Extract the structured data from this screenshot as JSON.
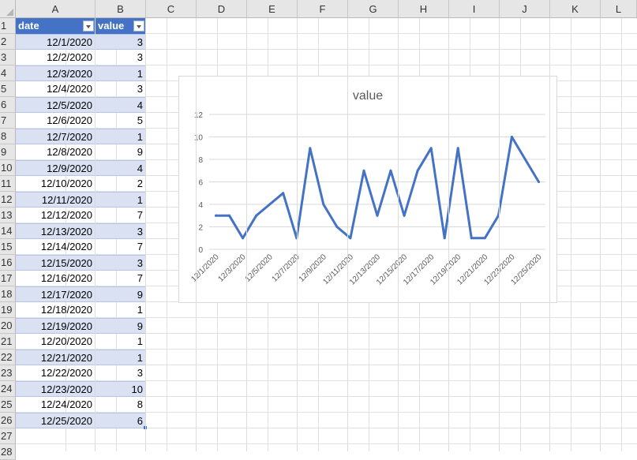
{
  "columns": [
    "A",
    "B",
    "C",
    "D",
    "E",
    "F",
    "G",
    "H",
    "I",
    "J",
    "K",
    "L"
  ],
  "rows": [
    "1",
    "2",
    "3",
    "4",
    "5",
    "6",
    "7",
    "8",
    "9",
    "10",
    "11",
    "12",
    "13",
    "14",
    "15",
    "16",
    "17",
    "18",
    "19",
    "20",
    "21",
    "22",
    "23",
    "24",
    "25",
    "26",
    "27",
    "28"
  ],
  "table": {
    "headers": [
      "date",
      "value"
    ],
    "dates": [
      "12/1/2020",
      "12/2/2020",
      "12/3/2020",
      "12/4/2020",
      "12/5/2020",
      "12/6/2020",
      "12/7/2020",
      "12/8/2020",
      "12/9/2020",
      "12/10/2020",
      "12/11/2020",
      "12/12/2020",
      "12/13/2020",
      "12/14/2020",
      "12/15/2020",
      "12/16/2020",
      "12/17/2020",
      "12/18/2020",
      "12/19/2020",
      "12/20/2020",
      "12/21/2020",
      "12/22/2020",
      "12/23/2020",
      "12/24/2020",
      "12/25/2020"
    ],
    "values": [
      "3",
      "3",
      "1",
      "3",
      "4",
      "5",
      "1",
      "9",
      "4",
      "2",
      "1",
      "7",
      "3",
      "7",
      "3",
      "7",
      "9",
      "1",
      "9",
      "1",
      "1",
      "3",
      "10",
      "8",
      "6"
    ]
  },
  "chart_data": {
    "type": "line",
    "title": "value",
    "x": [
      "12/1/2020",
      "12/2/2020",
      "12/3/2020",
      "12/4/2020",
      "12/5/2020",
      "12/6/2020",
      "12/7/2020",
      "12/8/2020",
      "12/9/2020",
      "12/10/2020",
      "12/11/2020",
      "12/12/2020",
      "12/13/2020",
      "12/14/2020",
      "12/15/2020",
      "12/16/2020",
      "12/17/2020",
      "12/18/2020",
      "12/19/2020",
      "12/20/2020",
      "12/21/2020",
      "12/22/2020",
      "12/23/2020",
      "12/24/2020",
      "12/25/2020"
    ],
    "series": [
      {
        "values": [
          3,
          3,
          1,
          3,
          4,
          5,
          1,
          9,
          4,
          2,
          1,
          7,
          3,
          7,
          3,
          7,
          9,
          1,
          9,
          1,
          1,
          3,
          10,
          8,
          6
        ]
      }
    ],
    "x_tick_labels": [
      "12/1/2020",
      "12/3/2020",
      "12/5/2020",
      "12/7/2020",
      "12/9/2020",
      "12/11/2020",
      "12/13/2020",
      "12/15/2020",
      "12/17/2020",
      "12/19/2020",
      "12/21/2020",
      "12/23/2020",
      "12/25/2020"
    ],
    "y_ticks": [
      "0",
      "2",
      "4",
      "6",
      "8",
      "10",
      "12"
    ],
    "ylim": [
      0,
      12
    ],
    "grid": true,
    "line_color": "#4472c4"
  },
  "colors": {
    "header_fill": "#4472c4",
    "band_fill": "#d9e1f2"
  }
}
